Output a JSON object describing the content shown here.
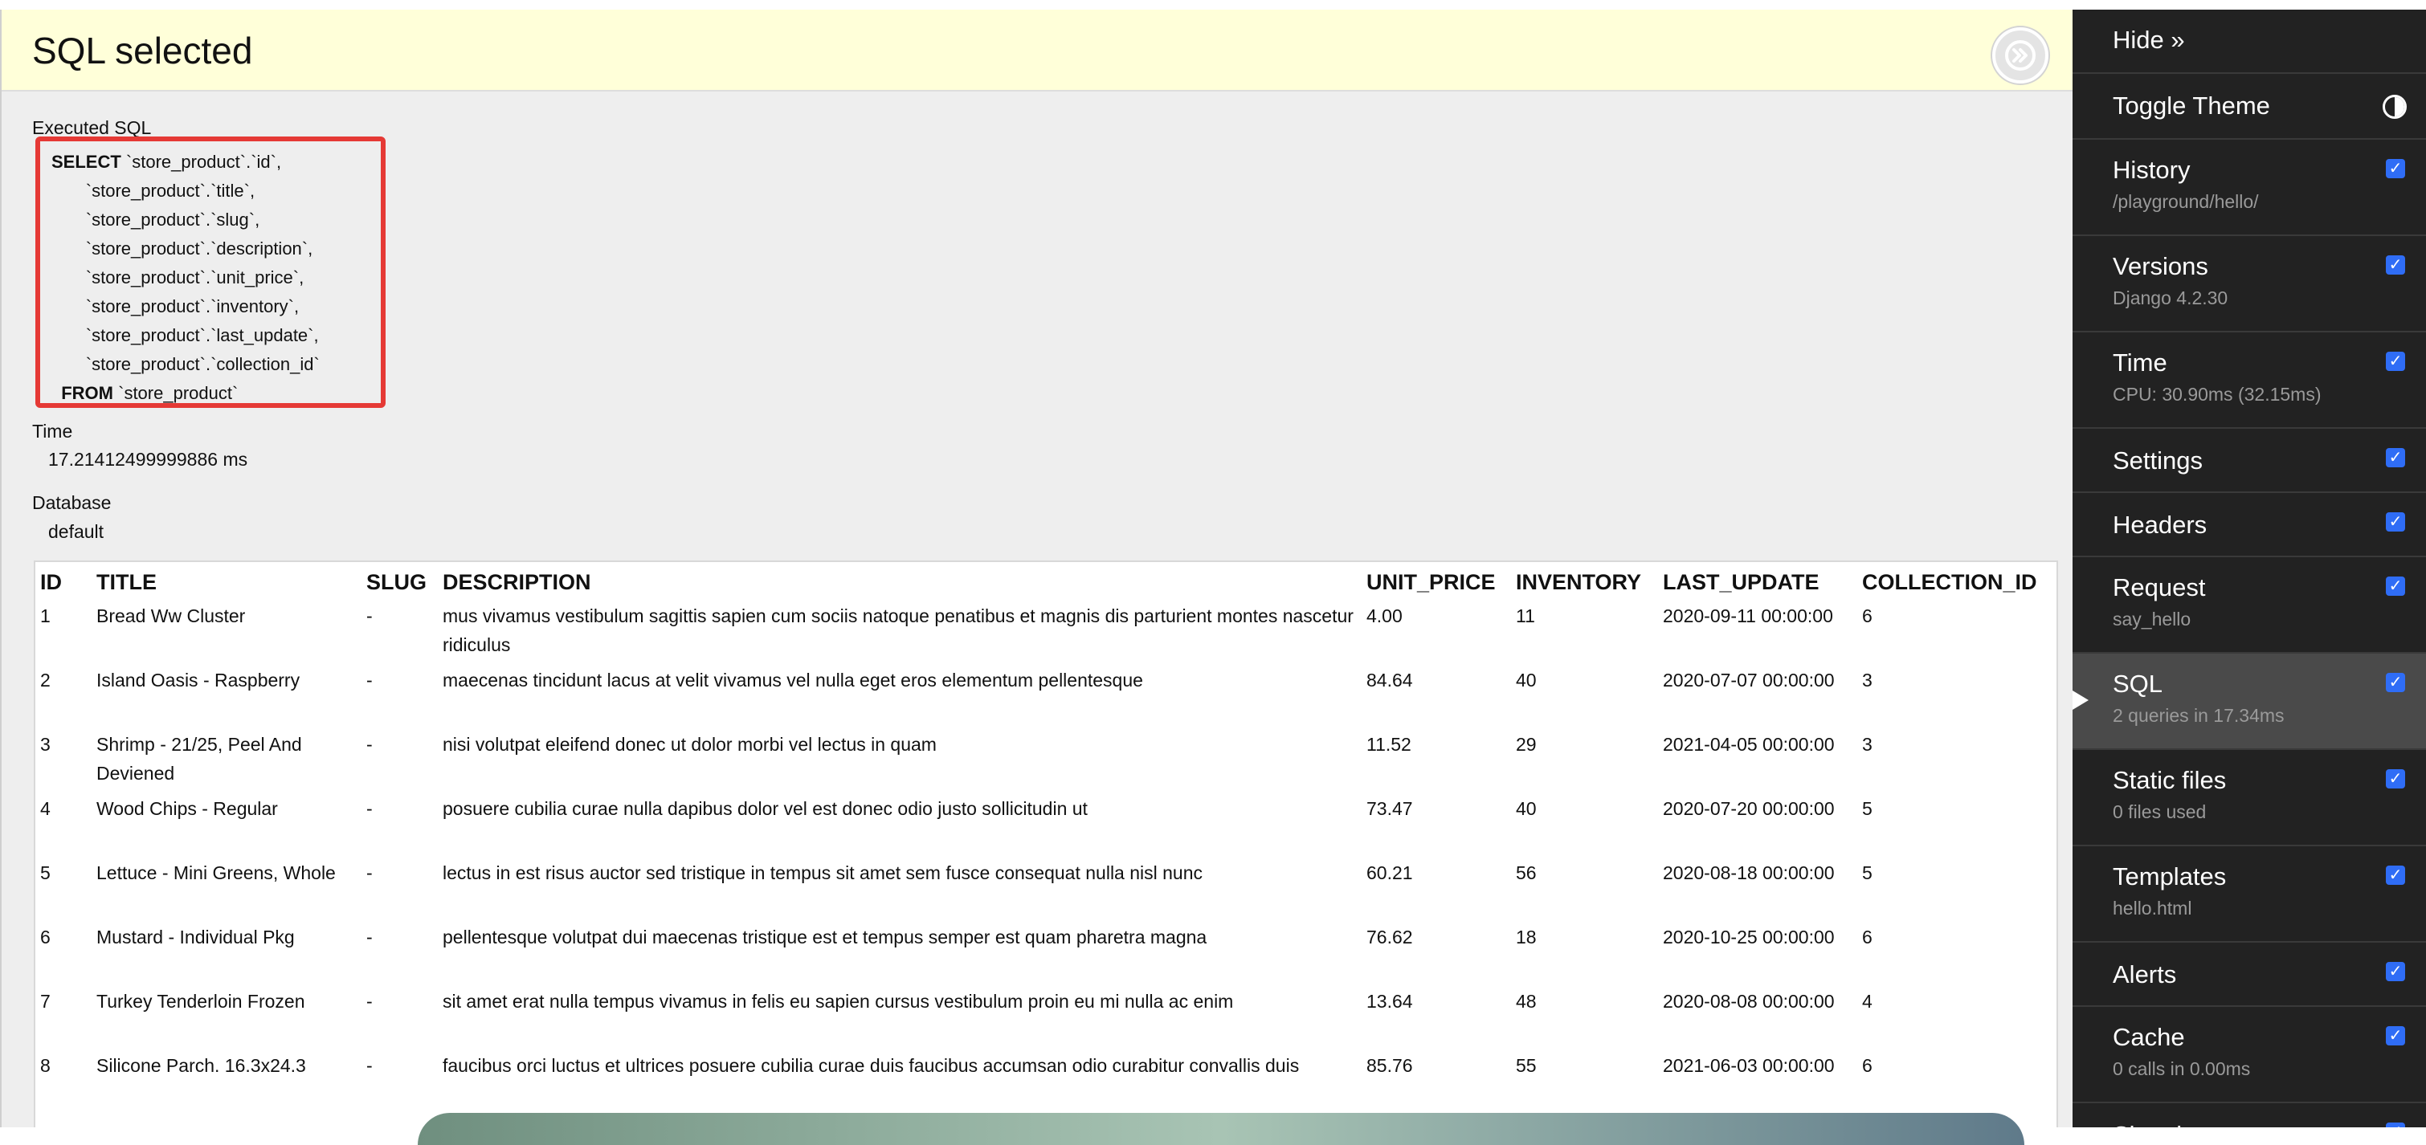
{
  "panel": {
    "title": "SQL selected",
    "executed_sql_label": "Executed SQL",
    "sql_lines": [
      {
        "kw": "SELECT",
        "rest": " `store_product`.`id`,"
      },
      {
        "kw": "",
        "rest": "       `store_product`.`title`,"
      },
      {
        "kw": "",
        "rest": "       `store_product`.`slug`,"
      },
      {
        "kw": "",
        "rest": "       `store_product`.`description`,"
      },
      {
        "kw": "",
        "rest": "       `store_product`.`unit_price`,"
      },
      {
        "kw": "",
        "rest": "       `store_product`.`inventory`,"
      },
      {
        "kw": "",
        "rest": "       `store_product`.`last_update`,"
      },
      {
        "kw": "",
        "rest": "       `store_product`.`collection_id`"
      },
      {
        "kw": "  FROM",
        "rest": " `store_product`"
      }
    ],
    "time_label": "Time",
    "time_value": "17.21412499999886 ms",
    "database_label": "Database",
    "database_value": "default"
  },
  "table": {
    "headers": [
      "ID",
      "TITLE",
      "SLUG",
      "DESCRIPTION",
      "UNIT_PRICE",
      "INVENTORY",
      "LAST_UPDATE",
      "COLLECTION_ID"
    ],
    "rows": [
      [
        "1",
        "Bread Ww Cluster",
        "-",
        "mus vivamus vestibulum sagittis sapien cum sociis natoque penatibus et magnis dis parturient montes nascetur ridiculus",
        "4.00",
        "11",
        "2020-09-11 00:00:00",
        "6"
      ],
      [
        "2",
        "Island Oasis - Raspberry",
        "-",
        "maecenas tincidunt lacus at velit vivamus vel nulla eget eros elementum pellentesque",
        "84.64",
        "40",
        "2020-07-07 00:00:00",
        "3"
      ],
      [
        "3",
        "Shrimp - 21/25, Peel And Deviened",
        "-",
        "nisi volutpat eleifend donec ut dolor morbi vel lectus in quam",
        "11.52",
        "29",
        "2021-04-05 00:00:00",
        "3"
      ],
      [
        "4",
        "Wood Chips - Regular",
        "-",
        "posuere cubilia curae nulla dapibus dolor vel est donec odio justo sollicitudin ut",
        "73.47",
        "40",
        "2020-07-20 00:00:00",
        "5"
      ],
      [
        "5",
        "Lettuce - Mini Greens, Whole",
        "-",
        "lectus in est risus auctor sed tristique in tempus sit amet sem fusce consequat nulla nisl nunc",
        "60.21",
        "56",
        "2020-08-18 00:00:00",
        "5"
      ],
      [
        "6",
        "Mustard - Individual Pkg",
        "-",
        "pellentesque volutpat dui maecenas tristique est et tempus semper est quam pharetra magna",
        "76.62",
        "18",
        "2020-10-25 00:00:00",
        "6"
      ],
      [
        "7",
        "Turkey Tenderloin Frozen",
        "-",
        "sit amet erat nulla tempus vivamus in felis eu sapien cursus vestibulum proin eu mi nulla ac enim",
        "13.64",
        "48",
        "2020-08-08 00:00:00",
        "4"
      ],
      [
        "8",
        "Silicone Parch. 16.3x24.3",
        "-",
        "faucibus orci luctus et ultrices posuere cubilia curae duis faucibus accumsan odio curabitur convallis duis",
        "85.76",
        "55",
        "2021-06-03 00:00:00",
        "6"
      ]
    ]
  },
  "sidebar": {
    "hide_label": "Hide »",
    "toggle_theme_label": "Toggle Theme",
    "panels": [
      {
        "id": "history",
        "title": "History",
        "subtitle": "/playground/hello/",
        "checked": true
      },
      {
        "id": "versions",
        "title": "Versions",
        "subtitle": "Django 4.2.30",
        "checked": true
      },
      {
        "id": "time",
        "title": "Time",
        "subtitle": "CPU: 30.90ms (32.15ms)",
        "checked": true
      },
      {
        "id": "settings",
        "title": "Settings",
        "subtitle": "",
        "checked": true
      },
      {
        "id": "headers",
        "title": "Headers",
        "subtitle": "",
        "checked": true
      },
      {
        "id": "request",
        "title": "Request",
        "subtitle": "say_hello",
        "checked": true
      },
      {
        "id": "sql",
        "title": "SQL",
        "subtitle": "2 queries in 17.34ms",
        "checked": true,
        "active": true
      },
      {
        "id": "static-files",
        "title": "Static files",
        "subtitle": "0 files used",
        "checked": true
      },
      {
        "id": "templates",
        "title": "Templates",
        "subtitle": "hello.html",
        "checked": true
      },
      {
        "id": "alerts",
        "title": "Alerts",
        "subtitle": "",
        "checked": true
      },
      {
        "id": "cache",
        "title": "Cache",
        "subtitle": "0 calls in 0.00ms",
        "checked": true
      },
      {
        "id": "signals",
        "title": "Signals",
        "subtitle": "",
        "checked": true
      }
    ]
  },
  "colors": {
    "title_bar": "#ffffd9",
    "sql_highlight": "#e53935",
    "sidebar_bg": "#222222",
    "sidebar_active": "#4a4a4a",
    "checkbox": "#2f6df6"
  }
}
